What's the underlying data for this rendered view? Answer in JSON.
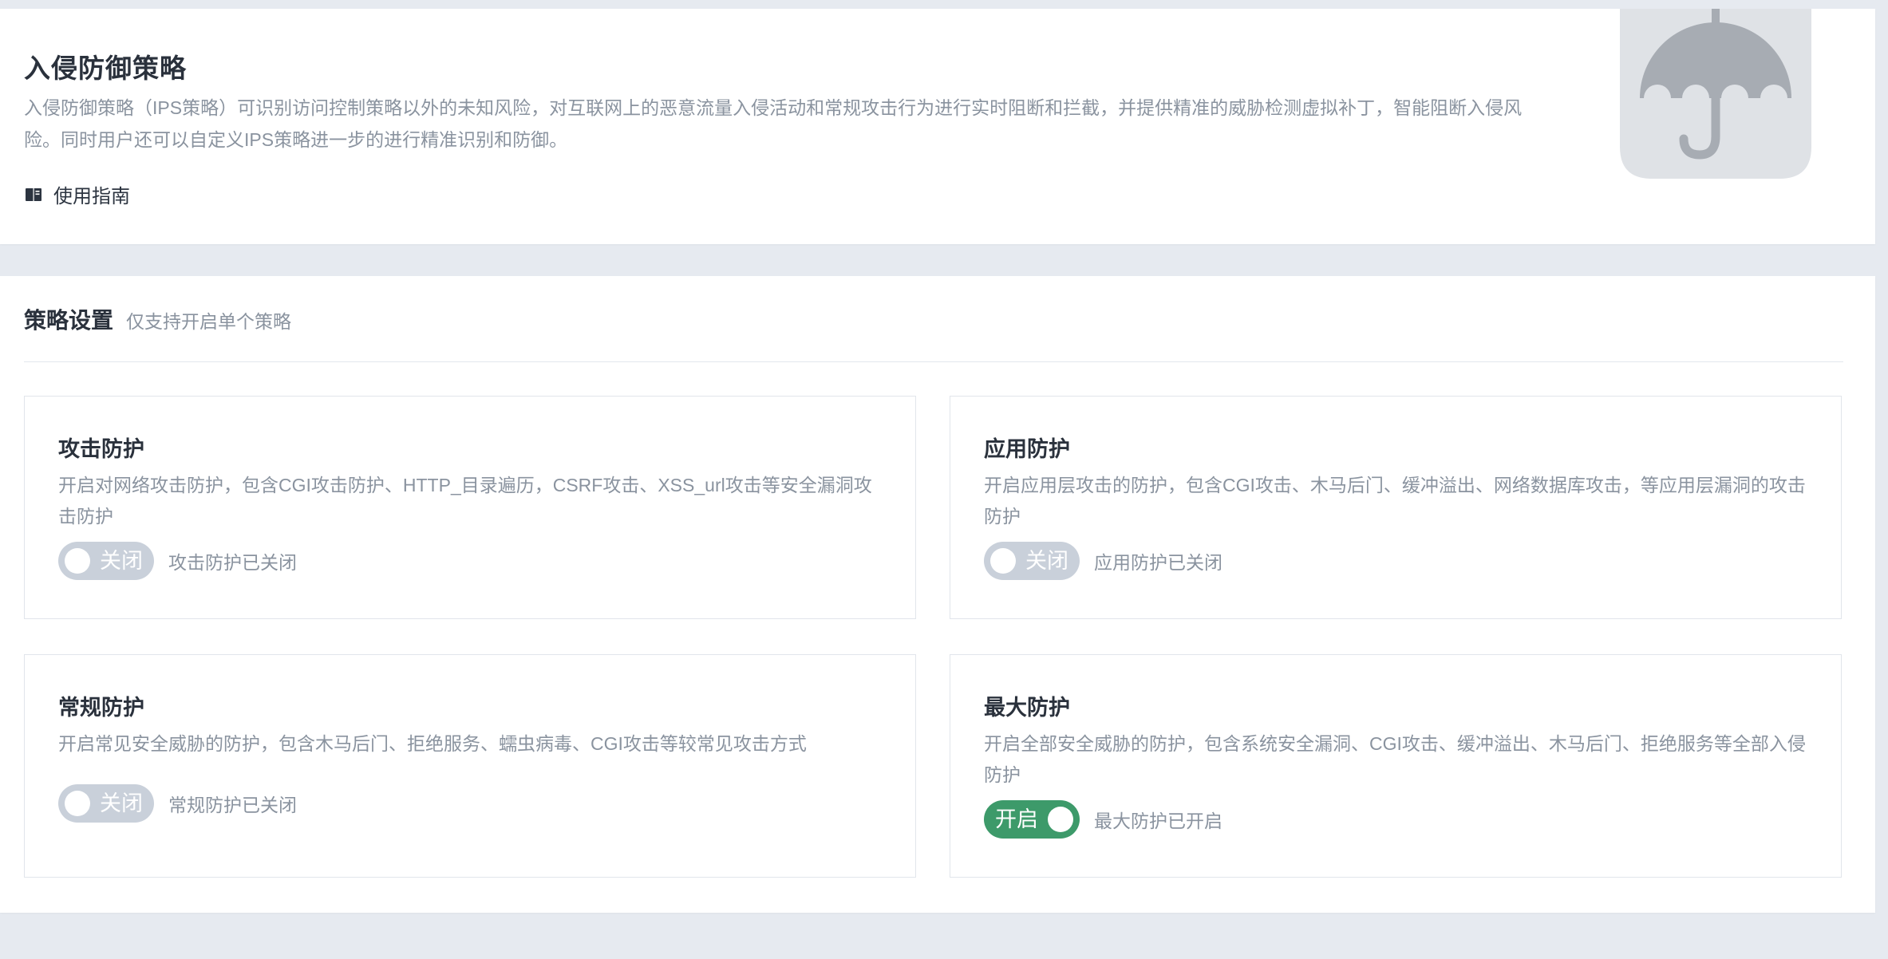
{
  "intro": {
    "title": "入侵防御策略",
    "description": "入侵防御策略（IPS策略）可识别访问控制策略以外的未知风险，对互联网上的恶意流量入侵活动和常规攻击行为进行实时阻断和拦截，并提供精准的威胁检测虚拟补丁，智能阻断入侵风险。同时用户还可以自定义IPS策略进一步的进行精准识别和防御。",
    "guide_label": "使用指南",
    "guide_icon": "book-icon",
    "illustration_icon": "umbrella-shield-icon"
  },
  "settings": {
    "title": "策略设置",
    "hint": "仅支持开启单个策略",
    "cards": [
      {
        "title": "攻击防护",
        "description": "开启对网络攻击防护，包含CGI攻击防护、HTTP_目录遍历，CSRF攻击、XSS_url攻击等安全漏洞攻击防护",
        "switch_label": "关闭",
        "enabled": false,
        "status": "攻击防护已关闭"
      },
      {
        "title": "应用防护",
        "description": "开启应用层攻击的防护，包含CGI攻击、木马后门、缓冲溢出、网络数据库攻击，等应用层漏洞的攻击防护",
        "switch_label": "关闭",
        "enabled": false,
        "status": "应用防护已关闭"
      },
      {
        "title": "常规防护",
        "description": "开启常见安全威胁的防护，包含木马后门、拒绝服务、蠕虫病毒、CGI攻击等较常见攻击方式",
        "switch_label": "关闭",
        "enabled": false,
        "status": "常规防护已关闭"
      },
      {
        "title": "最大防护",
        "description": "开启全部安全威胁的防护，包含系统安全漏洞、CGI攻击、缓冲溢出、木马后门、拒绝服务等全部入侵防护",
        "switch_label": "开启",
        "enabled": true,
        "status": "最大防护已开启"
      }
    ]
  },
  "colors": {
    "switch_on": "#3d9a6a",
    "switch_off": "#c9d0da",
    "page_background": "#e6eaf0"
  }
}
